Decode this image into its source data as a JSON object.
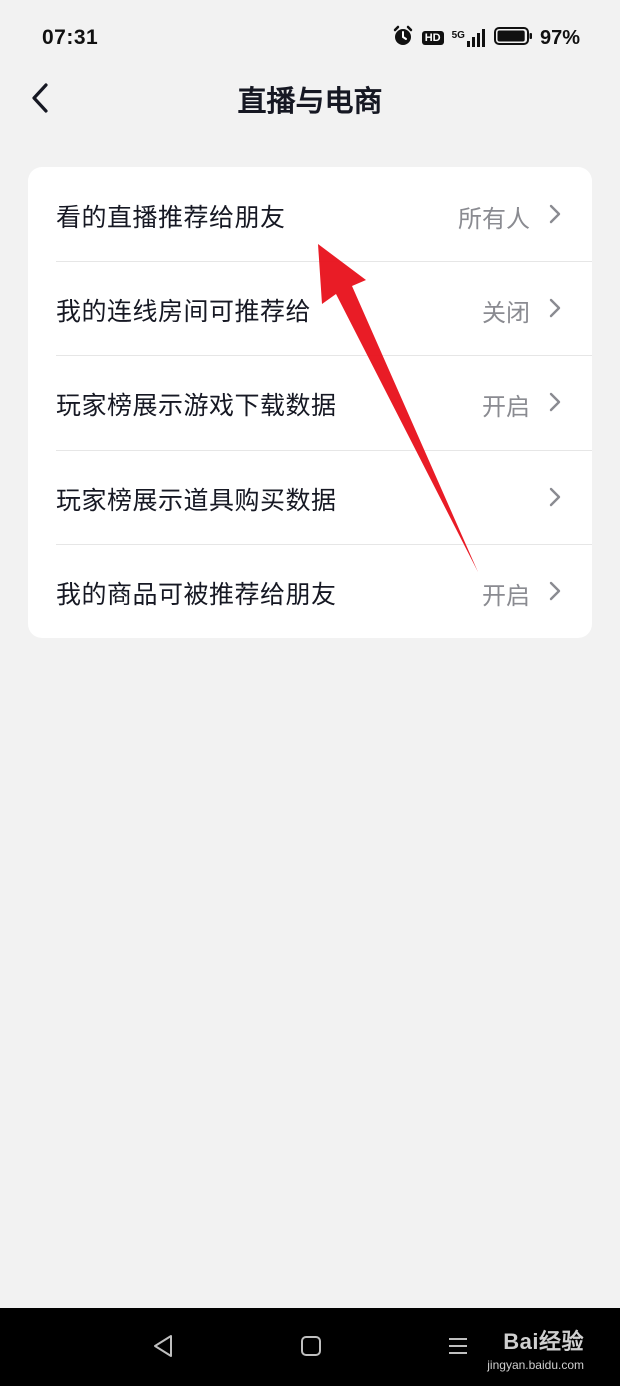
{
  "status_bar": {
    "time": "07:31",
    "hd_label": "HD",
    "network_label": "5G",
    "battery_percent": "97%",
    "battery_level": 0.97,
    "icons": [
      "alarm-icon",
      "hd-icon",
      "signal-icon",
      "battery-icon"
    ]
  },
  "header": {
    "back_icon": "chevron-left-icon",
    "title": "直播与电商"
  },
  "settings": {
    "rows": [
      {
        "label": "看的直播推荐给朋友",
        "value": "所有人"
      },
      {
        "label": "我的连线房间可推荐给",
        "value": "关闭"
      },
      {
        "label": "玩家榜展示游戏下载数据",
        "value": "开启"
      },
      {
        "label": "玩家榜展示道具购买数据",
        "value": ""
      },
      {
        "label": "我的商品可被推荐给朋友",
        "value": "开启"
      }
    ]
  },
  "navbar": {
    "icons": [
      "back-triangle-icon",
      "home-square-icon",
      "menu-lines-icon"
    ],
    "watermark_main": "Bai经验",
    "watermark_sub": "jingyan.baidu.com"
  },
  "colors": {
    "background": "#f2f2f2",
    "card": "#ffffff",
    "primary_text": "#161823",
    "secondary_text": "#8a8b91",
    "annotation_arrow": "#e8101a",
    "navbar": "#000000"
  }
}
